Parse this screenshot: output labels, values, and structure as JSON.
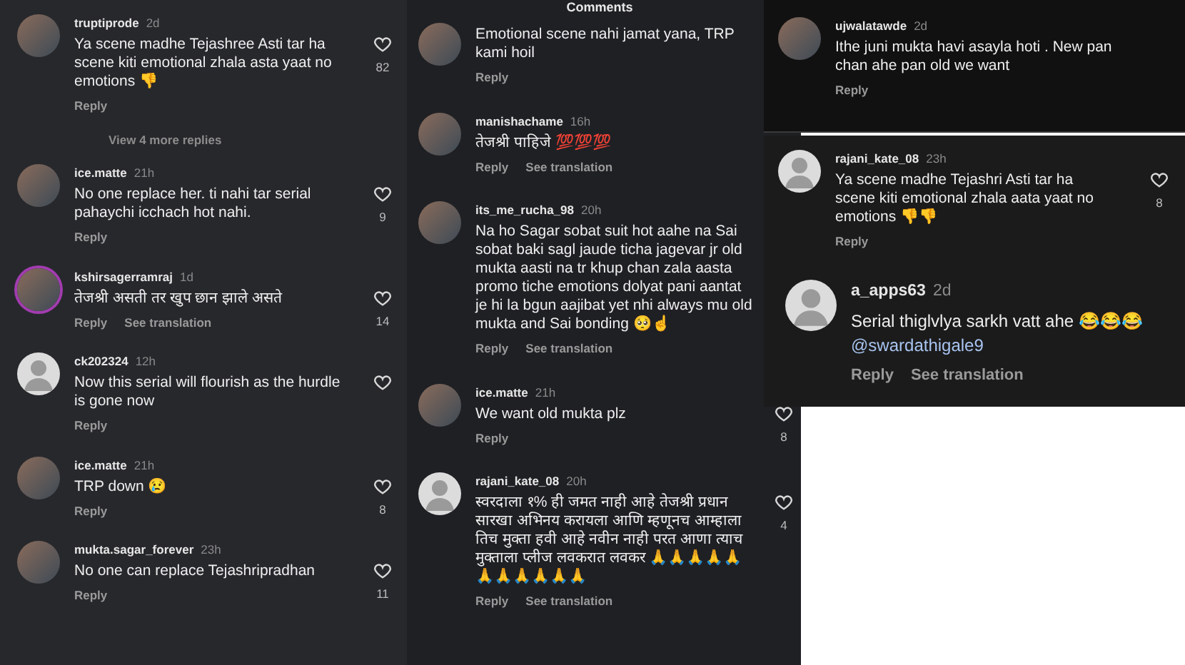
{
  "panels": [
    {
      "kind": "left",
      "items": [
        {
          "kind": "comment",
          "user": "truptiprode",
          "time": "2d",
          "text": "Ya scene madhe Tejashree Asti tar ha scene kiti emotional zhala asta yaat no emotions 👎",
          "reply": "Reply",
          "photo_avatar": true,
          "likes": "82",
          "like_button": true
        },
        {
          "kind": "more_replies",
          "text": "View 4 more replies"
        },
        {
          "kind": "comment",
          "user": "ice.matte",
          "time": "21h",
          "text": "No one replace her. ti nahi tar serial pahaychi icchach hot nahi.",
          "reply": "Reply",
          "photo_avatar": true,
          "likes": "9",
          "like_button": true
        },
        {
          "kind": "comment",
          "user": "kshirsagerramraj",
          "time": "1d",
          "text": "तेजश्री असती तर खुप छान झाले असते",
          "reply": "Reply",
          "translation": "See translation",
          "photo_avatar": true,
          "story_ring": true,
          "likes": "14",
          "like_button": true
        },
        {
          "kind": "comment",
          "user": "ck202324",
          "time": "12h",
          "text": "Now this serial will flourish as the hurdle is gone now",
          "reply": "Reply",
          "photo_avatar": false,
          "like_button": true
        },
        {
          "kind": "comment",
          "user": "ice.matte",
          "time": "21h",
          "text": "TRP down 😢",
          "reply": "Reply",
          "photo_avatar": true,
          "likes": "8",
          "like_button": true
        },
        {
          "kind": "comment",
          "user": "mukta.sagar_forever",
          "time": "23h",
          "text": "No one can replace Tejashripradhan",
          "reply": "Reply",
          "photo_avatar": true,
          "likes": "11",
          "like_button": true
        }
      ]
    },
    {
      "kind": "middle",
      "header": "Comments",
      "items": [
        {
          "kind": "comment",
          "text": "Emotional scene nahi jamat yana, TRP kami hoil",
          "reply": "Reply",
          "photo_avatar": true
        },
        {
          "kind": "comment",
          "user": "manishachame",
          "time": "16h",
          "text": "तेजश्री पाहिजे 💯💯💯",
          "reply": "Reply",
          "translation": "See translation",
          "photo_avatar": true
        },
        {
          "kind": "comment",
          "user": "its_me_rucha_98",
          "time": "20h",
          "text": "Na ho Sagar sobat suit hot aahe na Sai sobat baki sagl jaude ticha jagevar jr old mukta aasti na tr khup chan zala aasta promo tiche emotions dolyat pani aantat je hi la bgun aajibat yet nhi always mu old mukta and Sai bonding 🥺☝",
          "reply": "Reply",
          "translation": "See translation",
          "photo_avatar": true
        },
        {
          "kind": "comment",
          "user": "ice.matte",
          "time": "21h",
          "text": "We want old mukta plz",
          "reply": "Reply",
          "photo_avatar": true,
          "likes": "8",
          "like_button": true
        },
        {
          "kind": "comment",
          "user": "rajani_kate_08",
          "time": "20h",
          "text": "स्वरदाला १% ही जमत नाही आहे तेजश्री प्रधान सारखा अभिनय करायला आणि म्हणूनच आम्हाला तिच मुक्ता हवी आहे नवीन नाही परत आणा त्याच मुक्ताला प्लीज लवकरात लवकर 🙏🙏🙏🙏🙏🙏🙏🙏🙏🙏🙏",
          "reply": "Reply",
          "translation": "See translation",
          "photo_avatar": false,
          "likes": "4",
          "like_button": true
        }
      ]
    },
    {
      "kind": "right_top",
      "items": [
        {
          "kind": "comment",
          "user": "ujwalatawde",
          "time": "2d",
          "text": "Ithe juni mukta havi asayla hoti . New pan chan ahe pan old we want",
          "reply": "Reply",
          "photo_avatar": true
        }
      ]
    },
    {
      "kind": "right_bottom",
      "items": [
        {
          "kind": "comment",
          "user": "rajani_kate_08",
          "time": "23h",
          "text": "Ya scene madhe Tejashri Asti tar ha scene kiti emotional zhala aata yaat no emotions 👎👎",
          "reply": "Reply",
          "photo_avatar": false,
          "likes": "8",
          "like_button": true
        },
        {
          "kind": "comment_large",
          "user": "a_apps63",
          "time": "2d",
          "text": "Serial thiglvlya sarkh vatt ahe 😂😂😂",
          "mention": "@swardathigale9",
          "reply": "Reply",
          "translation": "See translation",
          "photo_avatar": false
        }
      ]
    }
  ]
}
